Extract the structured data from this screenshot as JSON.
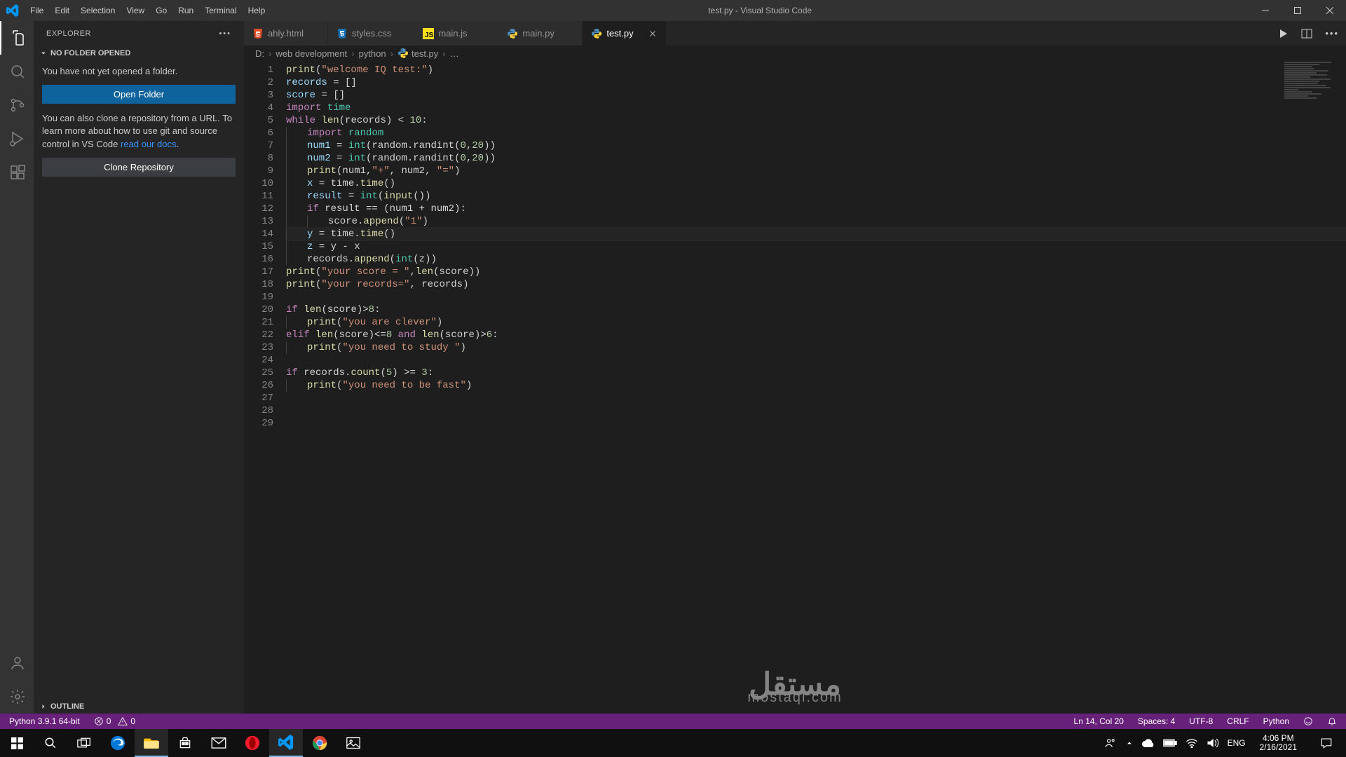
{
  "titlebar": {
    "title": "test.py - Visual Studio Code",
    "menus": [
      "File",
      "Edit",
      "Selection",
      "View",
      "Go",
      "Run",
      "Terminal",
      "Help"
    ]
  },
  "sidebar": {
    "explorer_label": "EXPLORER",
    "no_folder_label": "NO FOLDER OPENED",
    "not_opened_text": "You have not yet opened a folder.",
    "open_folder": "Open Folder",
    "clone_intro_1": "You can also clone a repository from a URL. To learn more about how to use git and source control in VS Code ",
    "docs_link": "read our docs",
    "period": ".",
    "clone_repo": "Clone Repository",
    "outline_label": "OUTLINE"
  },
  "tabs": [
    {
      "label": "ahly.html",
      "lang": "html"
    },
    {
      "label": "styles.css",
      "lang": "css"
    },
    {
      "label": "main.js",
      "lang": "js"
    },
    {
      "label": "main.py",
      "lang": "py"
    },
    {
      "label": "test.py",
      "lang": "py",
      "active": true
    }
  ],
  "breadcrumbs": {
    "d": "D:",
    "web": "web development",
    "py": "python",
    "file": "test.py",
    "dots": "…"
  },
  "code": {
    "cursor_line": 14,
    "lines": [
      [
        {
          "c": "builtin",
          "t": "print"
        },
        {
          "c": "op",
          "t": "("
        },
        {
          "c": "str",
          "t": "\"welcome IQ test:\""
        },
        {
          "c": "op",
          "t": ")"
        }
      ],
      [
        {
          "c": "var",
          "t": "records"
        },
        {
          "c": "op",
          "t": " = []"
        }
      ],
      [
        {
          "c": "var",
          "t": "score"
        },
        {
          "c": "op",
          "t": " = []"
        }
      ],
      [
        {
          "c": "kw",
          "t": "import"
        },
        {
          "c": "op",
          "t": " "
        },
        {
          "c": "type",
          "t": "time"
        }
      ],
      [
        {
          "c": "kw",
          "t": "while"
        },
        {
          "c": "op",
          "t": " "
        },
        {
          "c": "builtin",
          "t": "len"
        },
        {
          "c": "op",
          "t": "(records) < "
        },
        {
          "c": "num",
          "t": "10"
        },
        {
          "c": "op",
          "t": ":"
        }
      ],
      [
        {
          "indent": 1
        },
        {
          "c": "kw",
          "t": "import"
        },
        {
          "c": "op",
          "t": " "
        },
        {
          "c": "type",
          "t": "random"
        }
      ],
      [
        {
          "indent": 1
        },
        {
          "c": "var",
          "t": "num1"
        },
        {
          "c": "op",
          "t": " = "
        },
        {
          "c": "type",
          "t": "int"
        },
        {
          "c": "op",
          "t": "(random.randint("
        },
        {
          "c": "num",
          "t": "0"
        },
        {
          "c": "op",
          "t": ","
        },
        {
          "c": "num",
          "t": "20"
        },
        {
          "c": "op",
          "t": "))"
        }
      ],
      [
        {
          "indent": 1
        },
        {
          "c": "var",
          "t": "num2"
        },
        {
          "c": "op",
          "t": " = "
        },
        {
          "c": "type",
          "t": "int"
        },
        {
          "c": "op",
          "t": "(random.randint("
        },
        {
          "c": "num",
          "t": "0"
        },
        {
          "c": "op",
          "t": ","
        },
        {
          "c": "num",
          "t": "20"
        },
        {
          "c": "op",
          "t": "))"
        }
      ],
      [
        {
          "indent": 1
        },
        {
          "c": "builtin",
          "t": "print"
        },
        {
          "c": "op",
          "t": "(num1,"
        },
        {
          "c": "str",
          "t": "\"+\""
        },
        {
          "c": "op",
          "t": ", num2, "
        },
        {
          "c": "str",
          "t": "\"=\""
        },
        {
          "c": "op",
          "t": ")"
        }
      ],
      [
        {
          "indent": 1
        },
        {
          "c": "var",
          "t": "x"
        },
        {
          "c": "op",
          "t": " = time."
        },
        {
          "c": "builtin",
          "t": "time"
        },
        {
          "c": "op",
          "t": "()"
        }
      ],
      [
        {
          "indent": 1
        },
        {
          "c": "var",
          "t": "result"
        },
        {
          "c": "op",
          "t": " = "
        },
        {
          "c": "type",
          "t": "int"
        },
        {
          "c": "op",
          "t": "("
        },
        {
          "c": "builtin",
          "t": "input"
        },
        {
          "c": "op",
          "t": "())"
        }
      ],
      [
        {
          "indent": 1
        },
        {
          "c": "kw",
          "t": "if"
        },
        {
          "c": "op",
          "t": " result == (num1 + num2):"
        }
      ],
      [
        {
          "indent": 2
        },
        {
          "c": "op",
          "t": "score."
        },
        {
          "c": "builtin",
          "t": "append"
        },
        {
          "c": "op",
          "t": "("
        },
        {
          "c": "str",
          "t": "\"1\""
        },
        {
          "c": "op",
          "t": ")"
        }
      ],
      [
        {
          "indent": 1
        },
        {
          "c": "var",
          "t": "y"
        },
        {
          "c": "op",
          "t": " = time."
        },
        {
          "c": "builtin",
          "t": "time"
        },
        {
          "c": "op",
          "t": "()"
        }
      ],
      [
        {
          "indent": 1
        },
        {
          "c": "var",
          "t": "z"
        },
        {
          "c": "op",
          "t": " = y - x"
        }
      ],
      [
        {
          "indent": 1
        },
        {
          "c": "op",
          "t": "records."
        },
        {
          "c": "builtin",
          "t": "append"
        },
        {
          "c": "op",
          "t": "("
        },
        {
          "c": "type",
          "t": "int"
        },
        {
          "c": "op",
          "t": "(z))"
        }
      ],
      [
        {
          "c": "builtin",
          "t": "print"
        },
        {
          "c": "op",
          "t": "("
        },
        {
          "c": "str",
          "t": "\"your score = \""
        },
        {
          "c": "op",
          "t": ","
        },
        {
          "c": "builtin",
          "t": "len"
        },
        {
          "c": "op",
          "t": "(score))"
        }
      ],
      [
        {
          "c": "builtin",
          "t": "print"
        },
        {
          "c": "op",
          "t": "("
        },
        {
          "c": "str",
          "t": "\"your records=\""
        },
        {
          "c": "op",
          "t": ", records)"
        }
      ],
      [],
      [
        {
          "c": "kw",
          "t": "if"
        },
        {
          "c": "op",
          "t": " "
        },
        {
          "c": "builtin",
          "t": "len"
        },
        {
          "c": "op",
          "t": "(score)>"
        },
        {
          "c": "num",
          "t": "8"
        },
        {
          "c": "op",
          "t": ":"
        }
      ],
      [
        {
          "indent": 1
        },
        {
          "c": "builtin",
          "t": "print"
        },
        {
          "c": "op",
          "t": "("
        },
        {
          "c": "str",
          "t": "\"you are clever\""
        },
        {
          "c": "op",
          "t": ")"
        }
      ],
      [
        {
          "c": "kw",
          "t": "elif"
        },
        {
          "c": "op",
          "t": " "
        },
        {
          "c": "builtin",
          "t": "len"
        },
        {
          "c": "op",
          "t": "(score)<="
        },
        {
          "c": "num",
          "t": "8"
        },
        {
          "c": "op",
          "t": " "
        },
        {
          "c": "kw",
          "t": "and"
        },
        {
          "c": "op",
          "t": " "
        },
        {
          "c": "builtin",
          "t": "len"
        },
        {
          "c": "op",
          "t": "(score)>"
        },
        {
          "c": "num",
          "t": "6"
        },
        {
          "c": "op",
          "t": ":"
        }
      ],
      [
        {
          "indent": 1
        },
        {
          "c": "builtin",
          "t": "print"
        },
        {
          "c": "op",
          "t": "("
        },
        {
          "c": "str",
          "t": "\"you need to study \""
        },
        {
          "c": "op",
          "t": ")"
        }
      ],
      [],
      [
        {
          "c": "kw",
          "t": "if"
        },
        {
          "c": "op",
          "t": " records."
        },
        {
          "c": "builtin",
          "t": "count"
        },
        {
          "c": "op",
          "t": "("
        },
        {
          "c": "num",
          "t": "5"
        },
        {
          "c": "op",
          "t": ") >= "
        },
        {
          "c": "num",
          "t": "3"
        },
        {
          "c": "op",
          "t": ":"
        }
      ],
      [
        {
          "indent": 1
        },
        {
          "c": "builtin",
          "t": "print"
        },
        {
          "c": "op",
          "t": "("
        },
        {
          "c": "str",
          "t": "\"you need to be fast\""
        },
        {
          "c": "op",
          "t": ")"
        }
      ],
      [],
      [],
      []
    ]
  },
  "statusbar": {
    "python_env": "Python 3.9.1 64-bit",
    "errors": "0",
    "warnings": "0",
    "linecol": "Ln 14, Col 20",
    "spaces": "Spaces: 4",
    "encoding": "UTF-8",
    "eol": "CRLF",
    "language": "Python"
  },
  "taskbar": {
    "lang": "ENG",
    "time": "4:06 PM",
    "date": "2/16/2021"
  },
  "watermark": {
    "big": "مستقل",
    "small": "mostaql.com"
  }
}
